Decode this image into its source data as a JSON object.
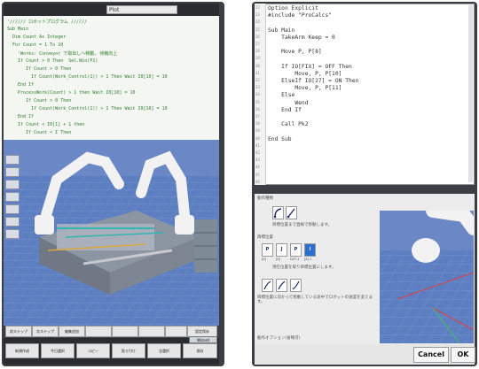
{
  "left": {
    "header_field": "Plot",
    "code_lines": [
      "'////// ロボットプログラム //////",
      "Sub Main",
      "  Dim Count As Integer",
      "  For Count = 1 To 10",
      "    'Works: Conveyor で取出しへ移動, 待機向上",
      "    If Count > 0 Then  Sel.Win(P1)",
      "       If Count > 0 Then",
      "         If Count(Work_Control(1)) > 1 Then Wait I0[10] = 10",
      "    End If",
      "    ProcessWork(Count) > 1 then Wait I0[10] = 10",
      "       If Count > 0 Then",
      "         If Count(Work_Control(1)) > 1 Then Wait I0[10] = 10",
      "    End If",
      "    If Count < I0[1] + 1 then",
      "       If Count < I Then"
    ],
    "buttons_row1": [
      "前ステップ",
      "次ステップ",
      "編集追加",
      "",
      "",
      "",
      "",
      "設定保存"
    ],
    "buttons_row2": [
      "新規作成",
      "今日選択",
      "コピー",
      "貼り付け",
      "全選択",
      "保存"
    ],
    "small_button": "Wizard"
  },
  "right": {
    "code_lines": [
      "Option Explicit",
      "#include \"ProCalcs\"",
      "",
      "Sub Main",
      "    TakeArm Keep = 0",
      "",
      "    Move P, P[8]",
      "",
      "    If IO[FIX] = OFF Then",
      "        Move, P, P[10]",
      "    ElseIf IO[27] = ON Then",
      "        Move, P, P[11]",
      "    Else",
      "        Wend",
      "    End If",
      "",
      "    Call Pk2",
      "",
      "End Sub"
    ],
    "line_numbers": [
      "22",
      "23",
      "24",
      "25",
      "26",
      "27",
      "28",
      "29",
      "30",
      "31",
      "32",
      "33",
      "34",
      "35",
      "36",
      "37",
      "38",
      "39",
      "40",
      "41",
      "42",
      "43",
      "44",
      "45",
      "46"
    ],
    "panel": {
      "section1_label": "動作種類",
      "section1_desc": "目標位置まで直線で移動します。",
      "section2_label": "目標位置",
      "section2_buttons": [
        "P",
        "J",
        "P",
        "I"
      ],
      "section2_sublabels": [
        "[8]",
        "[8]",
        "DUT-1",
        "[8]-1"
      ],
      "section2_desc": "現在位置を取り目標位置にします。",
      "section3_desc": "目標位置に向かって移動している途中でロボットの速度を変えます。",
      "section4_label": "動作オプション(省略可)"
    },
    "cancel_label": "Cancel",
    "ok_label": "OK"
  },
  "colors": {
    "tablet_frame": "#3b3e44",
    "viewport_blue": "#5f7fbf",
    "code_green": "#2a7d2a"
  }
}
